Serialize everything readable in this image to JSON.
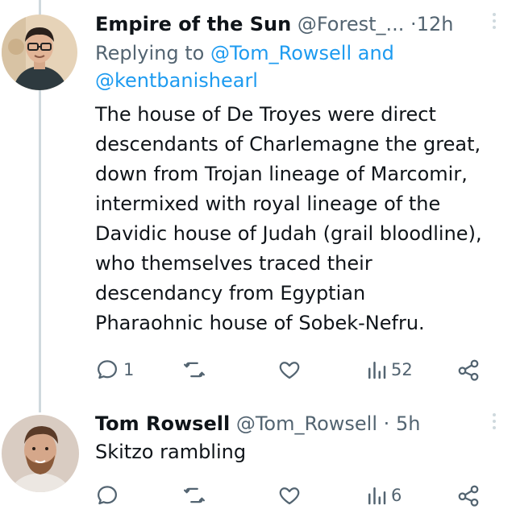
{
  "tweets": [
    {
      "author_name": "Empire of the Sun",
      "author_handle": "@Forest_...",
      "separator": "·",
      "time": "12h",
      "reply_prefix": "Replying to",
      "reply_mention_1": "@Tom_Rowsell",
      "reply_joiner": "and",
      "reply_mention_2": "@kentbanishearl",
      "body_lines": [
        "The house of De Troyes were direct",
        "descendants of Charlemagne the great,",
        "down from Trojan lineage of Marcomir,",
        "intermixed with royal lineage of the",
        "Davidic house of Judah (grail bloodline),",
        "who themselves traced their",
        "descendancy from Egyptian",
        "Pharaohnic house of Sobek-Nefru."
      ],
      "reply_count": "1",
      "retweet_count": "",
      "like_count": "",
      "view_count": "52"
    },
    {
      "author_name": "Tom Rowsell",
      "author_handle": "@Tom_Rowsell",
      "separator": "·",
      "time": "5h",
      "body_lines": [
        "Skitzo rambling"
      ],
      "reply_count": "",
      "retweet_count": "",
      "like_count": "",
      "view_count": "6"
    }
  ],
  "icons": {
    "reply": "reply-icon",
    "retweet": "retweet-icon",
    "like": "heart-icon",
    "views": "views-icon",
    "share": "share-icon",
    "more": "more-icon"
  },
  "colors": {
    "text": "#0f1419",
    "secondary": "#536471",
    "link": "#1d9bf0",
    "thread_line": "#cfd9de"
  }
}
